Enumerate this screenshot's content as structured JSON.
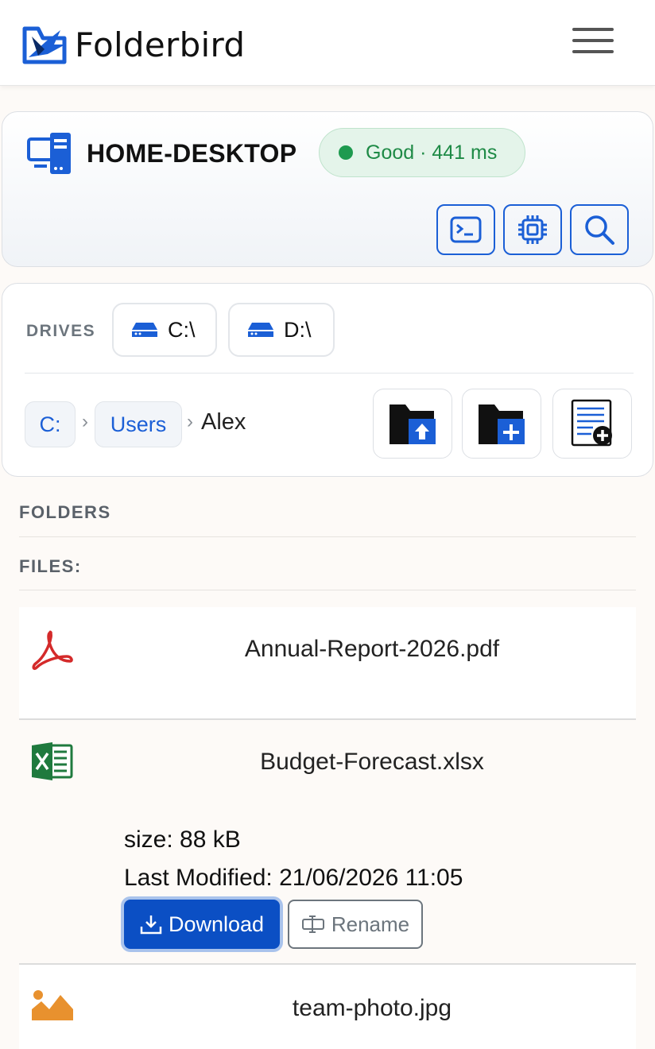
{
  "app": {
    "brand_name": "Folderbird"
  },
  "host": {
    "name": "HOME-DESKTOP",
    "status_text": "Good · 441 ms",
    "status_color": "#1e9a4f",
    "tools": [
      {
        "icon": "terminal-icon"
      },
      {
        "icon": "cpu-chip-icon"
      },
      {
        "icon": "search-icon"
      }
    ]
  },
  "drives": {
    "label": "DRIVES",
    "items": [
      {
        "label": "C:\\",
        "icon": "hard-drive-icon"
      },
      {
        "label": "D:\\",
        "icon": "hard-drive-icon"
      }
    ]
  },
  "breadcrumb": {
    "items": [
      {
        "label": "C:"
      },
      {
        "label": "Users"
      }
    ],
    "separator": "›",
    "current": "Alex",
    "actions": [
      {
        "icon": "folder-upload-icon"
      },
      {
        "icon": "new-folder-icon"
      },
      {
        "icon": "new-file-icon"
      }
    ]
  },
  "sections": {
    "folders_label": "FOLDERS",
    "files_label": "FILES:"
  },
  "files": [
    {
      "name": "Annual-Report-2026.pdf",
      "icon": "pdf-file-icon"
    },
    {
      "name": "Budget-Forecast.xlsx",
      "icon": "excel-file-icon",
      "size_text": "size: 88 kB",
      "modified_text": "Last Modified: 21/06/2026 11:05",
      "download_label": "Download",
      "rename_label": "Rename"
    },
    {
      "name": "team-photo.jpg",
      "icon": "image-file-icon"
    }
  ],
  "colors": {
    "accent": "#1b5fd6",
    "primary_button": "#0b4fc4",
    "status_green": "#1e8a46"
  }
}
